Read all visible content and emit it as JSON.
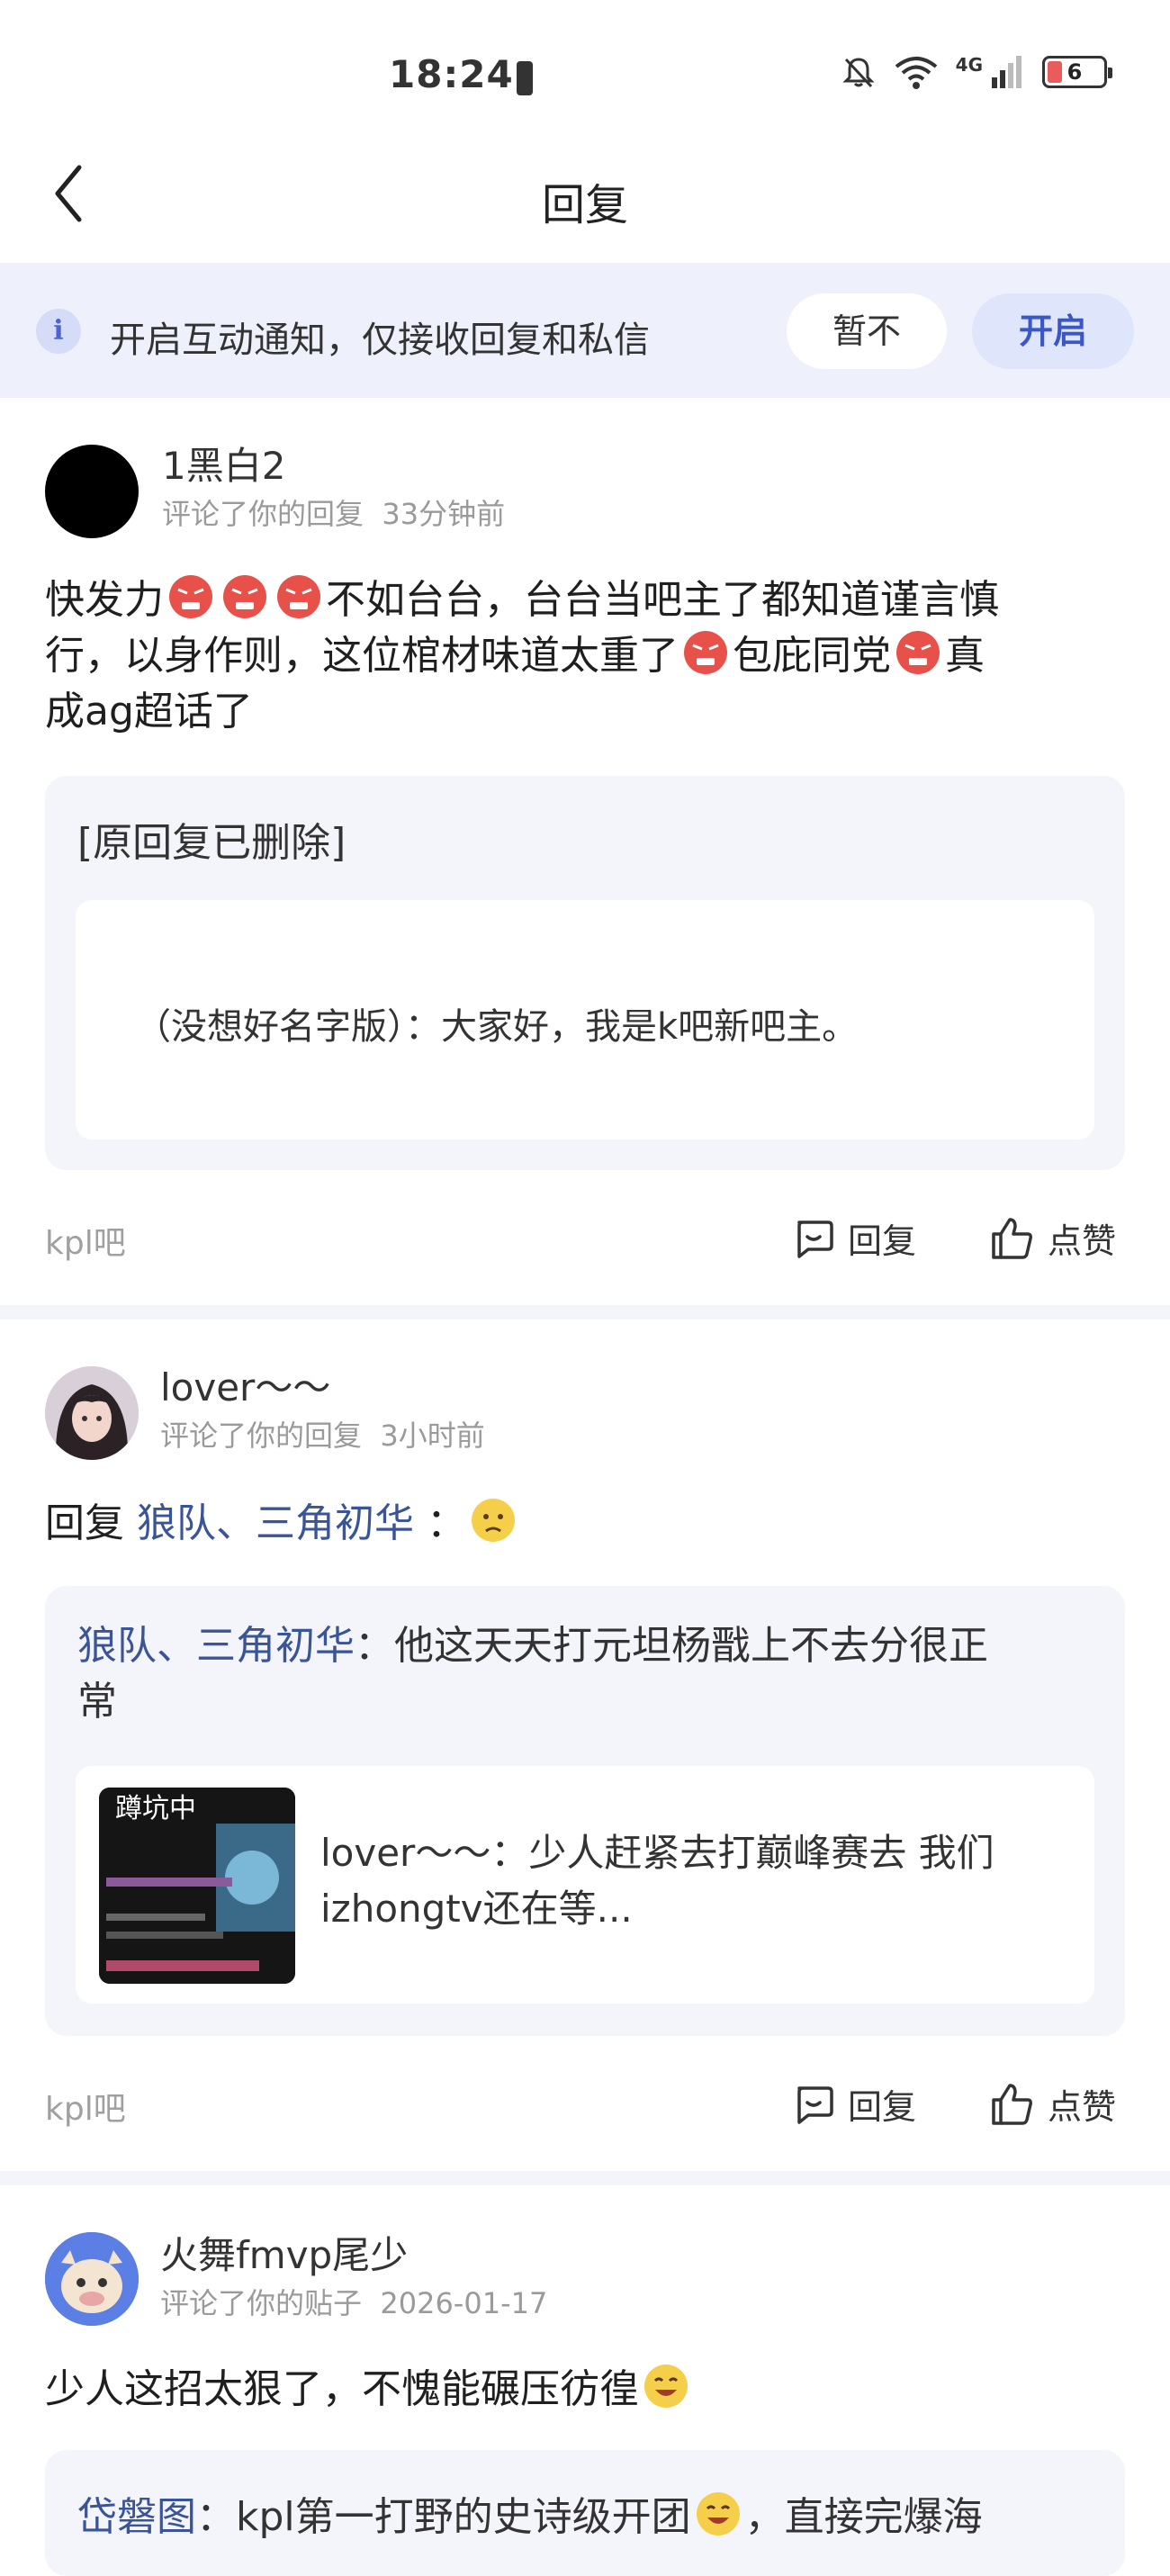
{
  "status_bar": {
    "time": "18:24",
    "battery": "6",
    "network": "4G"
  },
  "nav": {
    "title": "回复",
    "back_icon": "chevron-left-icon"
  },
  "banner": {
    "icon": "info-icon",
    "info_glyph": "i",
    "text": "开启互动通知，仅接收回复和私信",
    "later_label": "暂不",
    "enable_label": "开启"
  },
  "items": [
    {
      "user": "1黑白2",
      "action": "评论了你的回复",
      "time": "33分钟前",
      "body_parts": [
        "快发力",
        "不如台台，台台当吧主了都知道谨言慎",
        "行，以身作则，这位棺材味道太重了",
        "包庇同党",
        "真",
        "成ag超话了"
      ],
      "quote_deleted": "[原回复已删除]",
      "quote_inner": "（没想好名字版）：大家好，我是k吧新吧主。",
      "forum": "kpl吧",
      "reply_label": "回复",
      "like_label": "点赞"
    },
    {
      "user": "lover～～",
      "action": "评论了你的回复",
      "time": "3小时前",
      "reply_prefix": "回复",
      "reply_target": "狼队、三角初华",
      "reply_sep": "：",
      "quote_author": "狼队、三角初华",
      "quote_text_1": "：他这天天打元坦杨戬上不去分很正",
      "quote_text_2": "常",
      "thumb_text": "蹲坑中",
      "inner_line_1": "lover～～：少人赶紧去打巅峰赛去 我们",
      "inner_line_2": "izhongtv还在等...",
      "forum": "kpl吧",
      "reply_label": "回复",
      "like_label": "点赞"
    },
    {
      "user": "火舞fmvp尾少",
      "action": "评论了你的贴子",
      "time": "2026-01-17",
      "body": "少人这招太狠了，不愧能碾压彷徨",
      "quote_author": "岱磐图",
      "quote_text": "：kpl第一打野的史诗级开团",
      "quote_tail": "，直接完爆海"
    }
  ]
}
